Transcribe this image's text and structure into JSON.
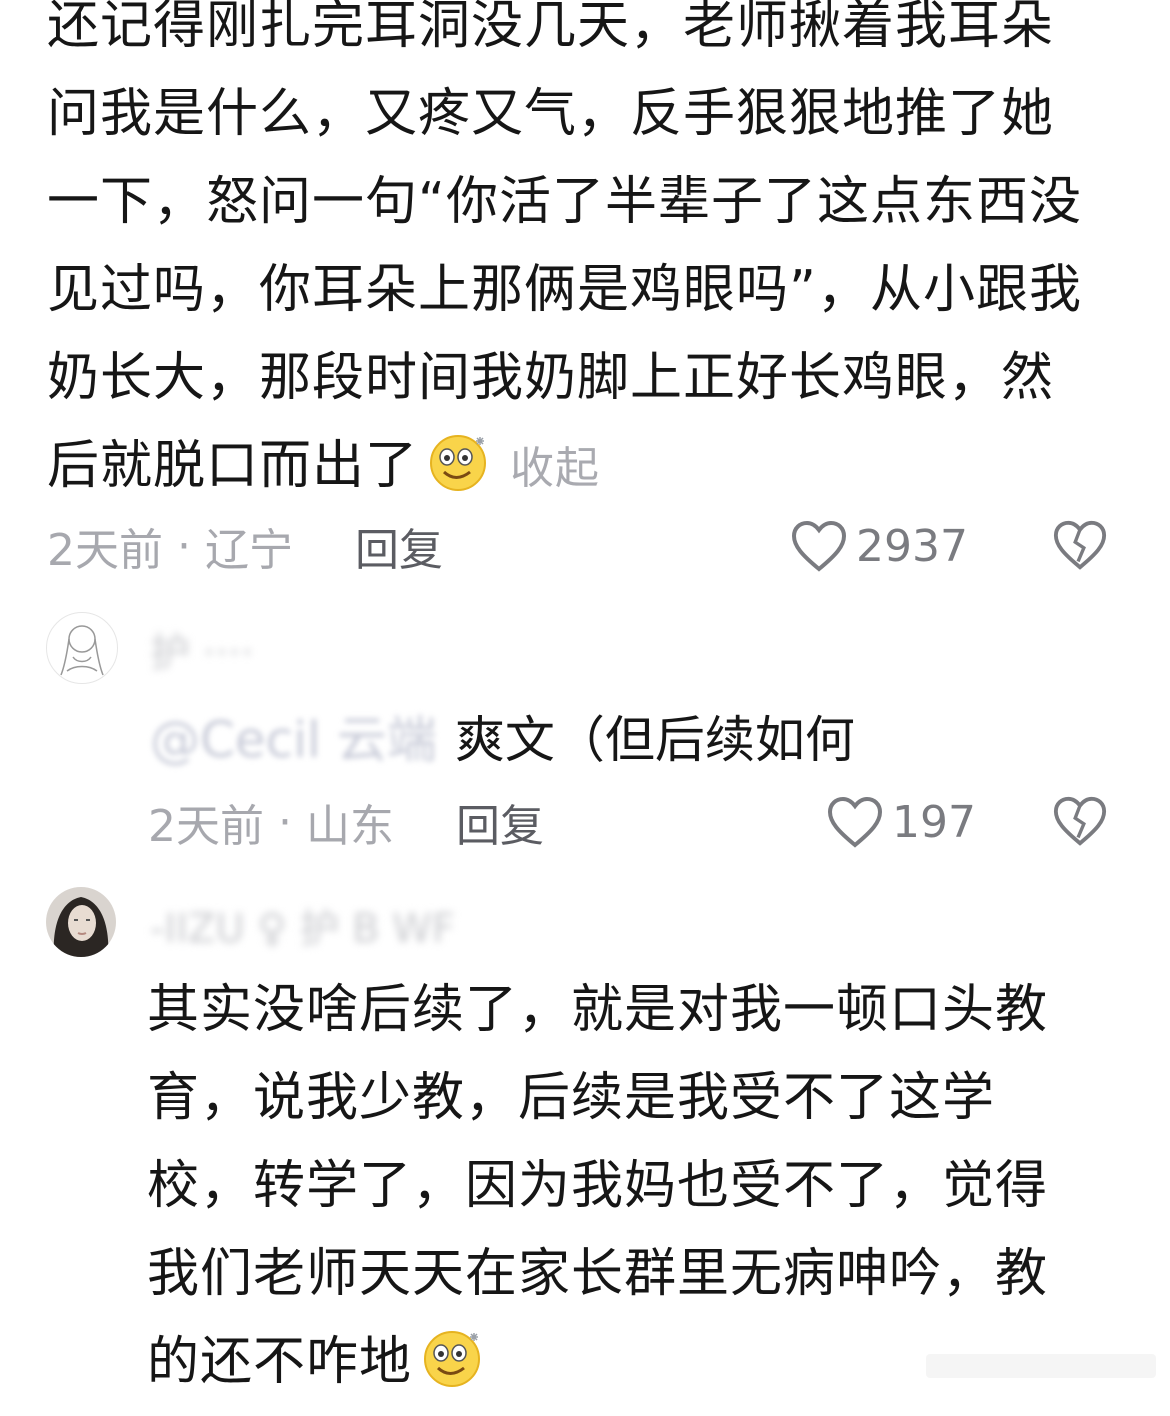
{
  "comment1": {
    "lines": [
      "还记得刚扎完耳洞没几天，老师揪着我耳朵",
      "问我是什么，又疼又气，反手狠狠地推了她",
      "一下，怒问一句“你活了半辈子了这点东西没",
      "见过吗，你耳朵上那俩是鸡眼吗”，从小跟我",
      "奶长大，那段时间我奶脚上正好长鸡眼，然",
      "后就脱口而出了"
    ],
    "collapse_label": "收起",
    "time": "2天前",
    "location": "辽宁",
    "reply_label": "回复",
    "likes": "2937"
  },
  "comment2": {
    "mention": "@Cecil 云端",
    "content": "爽文（但后续如何",
    "time": "2天前",
    "location": "山东",
    "reply_label": "回复",
    "likes": "197"
  },
  "comment3": {
    "lines": [
      "其实没啥后续了，就是对我一顿口头教",
      "育，说我少教，后续是我受不了这学",
      "校，转学了，因为我妈也受不了，觉得",
      "我们老师天天在家长群里无病呻吟，教",
      "的还不咋地"
    ]
  },
  "icons": {
    "emoji": "sweat-smile-emoji-icon",
    "like": "heart-outline-icon",
    "dislike": "broken-heart-icon"
  },
  "colors": {
    "text": "#161616",
    "meta": "#a7a8ae",
    "reply": "#5b5c62",
    "like": "#7a7b80"
  }
}
